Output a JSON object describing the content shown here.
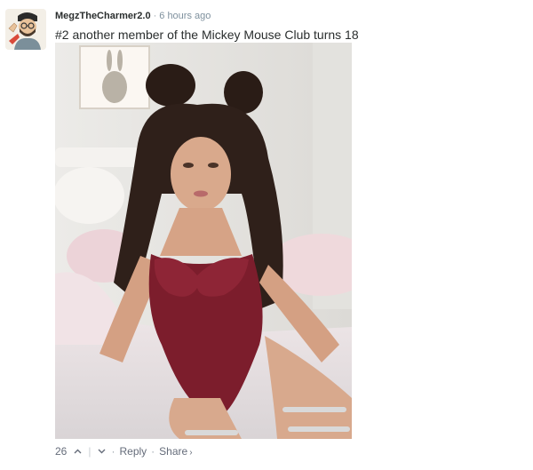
{
  "comment": {
    "username": "MegzTheCharmer2.0",
    "separator": "·",
    "timestamp": "6 hours ago",
    "text": "#2 another member of the Mickey Mouse Club turns 18"
  },
  "footer": {
    "vote_count": "26",
    "bullet": "·",
    "reply_label": "Reply",
    "share_label": "Share",
    "share_chevron": "›"
  },
  "colors": {
    "text": "#2a2e2e",
    "muted": "#656c7a",
    "timestamp": "#7f919e"
  },
  "icons": [
    "avatar-cartoon",
    "chevron-up-icon",
    "chevron-down-icon"
  ]
}
